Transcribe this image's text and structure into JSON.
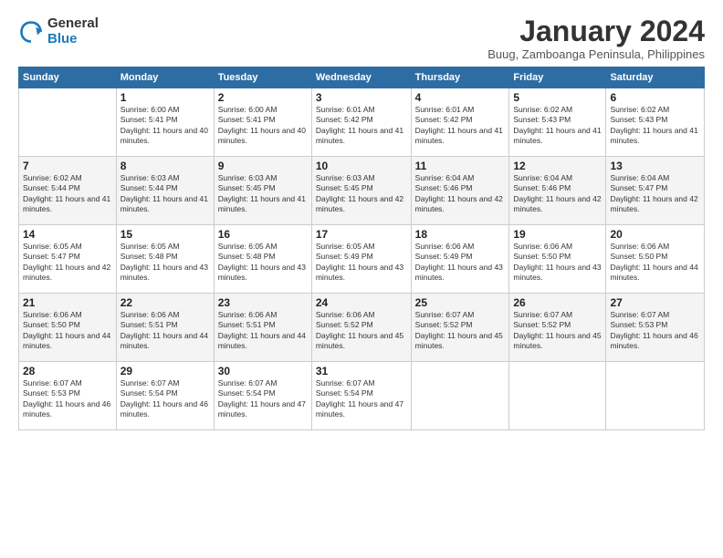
{
  "header": {
    "logo_line1": "General",
    "logo_line2": "Blue",
    "month": "January 2024",
    "location": "Buug, Zamboanga Peninsula, Philippines"
  },
  "days_of_week": [
    "Sunday",
    "Monday",
    "Tuesday",
    "Wednesday",
    "Thursday",
    "Friday",
    "Saturday"
  ],
  "weeks": [
    [
      {
        "day": "",
        "sunrise": "",
        "sunset": "",
        "daylight": ""
      },
      {
        "day": "1",
        "sunrise": "Sunrise: 6:00 AM",
        "sunset": "Sunset: 5:41 PM",
        "daylight": "Daylight: 11 hours and 40 minutes."
      },
      {
        "day": "2",
        "sunrise": "Sunrise: 6:00 AM",
        "sunset": "Sunset: 5:41 PM",
        "daylight": "Daylight: 11 hours and 40 minutes."
      },
      {
        "day": "3",
        "sunrise": "Sunrise: 6:01 AM",
        "sunset": "Sunset: 5:42 PM",
        "daylight": "Daylight: 11 hours and 41 minutes."
      },
      {
        "day": "4",
        "sunrise": "Sunrise: 6:01 AM",
        "sunset": "Sunset: 5:42 PM",
        "daylight": "Daylight: 11 hours and 41 minutes."
      },
      {
        "day": "5",
        "sunrise": "Sunrise: 6:02 AM",
        "sunset": "Sunset: 5:43 PM",
        "daylight": "Daylight: 11 hours and 41 minutes."
      },
      {
        "day": "6",
        "sunrise": "Sunrise: 6:02 AM",
        "sunset": "Sunset: 5:43 PM",
        "daylight": "Daylight: 11 hours and 41 minutes."
      }
    ],
    [
      {
        "day": "7",
        "sunrise": "Sunrise: 6:02 AM",
        "sunset": "Sunset: 5:44 PM",
        "daylight": "Daylight: 11 hours and 41 minutes."
      },
      {
        "day": "8",
        "sunrise": "Sunrise: 6:03 AM",
        "sunset": "Sunset: 5:44 PM",
        "daylight": "Daylight: 11 hours and 41 minutes."
      },
      {
        "day": "9",
        "sunrise": "Sunrise: 6:03 AM",
        "sunset": "Sunset: 5:45 PM",
        "daylight": "Daylight: 11 hours and 41 minutes."
      },
      {
        "day": "10",
        "sunrise": "Sunrise: 6:03 AM",
        "sunset": "Sunset: 5:45 PM",
        "daylight": "Daylight: 11 hours and 42 minutes."
      },
      {
        "day": "11",
        "sunrise": "Sunrise: 6:04 AM",
        "sunset": "Sunset: 5:46 PM",
        "daylight": "Daylight: 11 hours and 42 minutes."
      },
      {
        "day": "12",
        "sunrise": "Sunrise: 6:04 AM",
        "sunset": "Sunset: 5:46 PM",
        "daylight": "Daylight: 11 hours and 42 minutes."
      },
      {
        "day": "13",
        "sunrise": "Sunrise: 6:04 AM",
        "sunset": "Sunset: 5:47 PM",
        "daylight": "Daylight: 11 hours and 42 minutes."
      }
    ],
    [
      {
        "day": "14",
        "sunrise": "Sunrise: 6:05 AM",
        "sunset": "Sunset: 5:47 PM",
        "daylight": "Daylight: 11 hours and 42 minutes."
      },
      {
        "day": "15",
        "sunrise": "Sunrise: 6:05 AM",
        "sunset": "Sunset: 5:48 PM",
        "daylight": "Daylight: 11 hours and 43 minutes."
      },
      {
        "day": "16",
        "sunrise": "Sunrise: 6:05 AM",
        "sunset": "Sunset: 5:48 PM",
        "daylight": "Daylight: 11 hours and 43 minutes."
      },
      {
        "day": "17",
        "sunrise": "Sunrise: 6:05 AM",
        "sunset": "Sunset: 5:49 PM",
        "daylight": "Daylight: 11 hours and 43 minutes."
      },
      {
        "day": "18",
        "sunrise": "Sunrise: 6:06 AM",
        "sunset": "Sunset: 5:49 PM",
        "daylight": "Daylight: 11 hours and 43 minutes."
      },
      {
        "day": "19",
        "sunrise": "Sunrise: 6:06 AM",
        "sunset": "Sunset: 5:50 PM",
        "daylight": "Daylight: 11 hours and 43 minutes."
      },
      {
        "day": "20",
        "sunrise": "Sunrise: 6:06 AM",
        "sunset": "Sunset: 5:50 PM",
        "daylight": "Daylight: 11 hours and 44 minutes."
      }
    ],
    [
      {
        "day": "21",
        "sunrise": "Sunrise: 6:06 AM",
        "sunset": "Sunset: 5:50 PM",
        "daylight": "Daylight: 11 hours and 44 minutes."
      },
      {
        "day": "22",
        "sunrise": "Sunrise: 6:06 AM",
        "sunset": "Sunset: 5:51 PM",
        "daylight": "Daylight: 11 hours and 44 minutes."
      },
      {
        "day": "23",
        "sunrise": "Sunrise: 6:06 AM",
        "sunset": "Sunset: 5:51 PM",
        "daylight": "Daylight: 11 hours and 44 minutes."
      },
      {
        "day": "24",
        "sunrise": "Sunrise: 6:06 AM",
        "sunset": "Sunset: 5:52 PM",
        "daylight": "Daylight: 11 hours and 45 minutes."
      },
      {
        "day": "25",
        "sunrise": "Sunrise: 6:07 AM",
        "sunset": "Sunset: 5:52 PM",
        "daylight": "Daylight: 11 hours and 45 minutes."
      },
      {
        "day": "26",
        "sunrise": "Sunrise: 6:07 AM",
        "sunset": "Sunset: 5:52 PM",
        "daylight": "Daylight: 11 hours and 45 minutes."
      },
      {
        "day": "27",
        "sunrise": "Sunrise: 6:07 AM",
        "sunset": "Sunset: 5:53 PM",
        "daylight": "Daylight: 11 hours and 46 minutes."
      }
    ],
    [
      {
        "day": "28",
        "sunrise": "Sunrise: 6:07 AM",
        "sunset": "Sunset: 5:53 PM",
        "daylight": "Daylight: 11 hours and 46 minutes."
      },
      {
        "day": "29",
        "sunrise": "Sunrise: 6:07 AM",
        "sunset": "Sunset: 5:54 PM",
        "daylight": "Daylight: 11 hours and 46 minutes."
      },
      {
        "day": "30",
        "sunrise": "Sunrise: 6:07 AM",
        "sunset": "Sunset: 5:54 PM",
        "daylight": "Daylight: 11 hours and 47 minutes."
      },
      {
        "day": "31",
        "sunrise": "Sunrise: 6:07 AM",
        "sunset": "Sunset: 5:54 PM",
        "daylight": "Daylight: 11 hours and 47 minutes."
      },
      {
        "day": "",
        "sunrise": "",
        "sunset": "",
        "daylight": ""
      },
      {
        "day": "",
        "sunrise": "",
        "sunset": "",
        "daylight": ""
      },
      {
        "day": "",
        "sunrise": "",
        "sunset": "",
        "daylight": ""
      }
    ]
  ]
}
